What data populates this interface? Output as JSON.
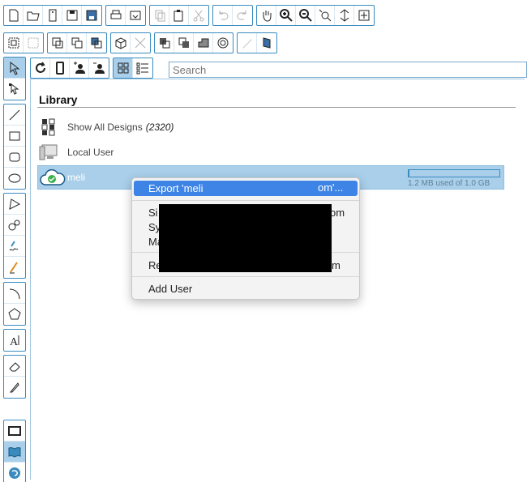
{
  "search": {
    "placeholder": "Search"
  },
  "library": {
    "title": "Library",
    "show_all_label": "Show All Designs",
    "show_all_count": "(2320)",
    "local_user_label": "Local User",
    "cloud_user_name": "meli",
    "storage_text": "1.2 MB used of 1.0 GB",
    "storage_fraction": 0.0012
  },
  "context_menu": {
    "export_label": "Export 'meli",
    "export_tail": "om'...",
    "item2_prefix": "Si",
    "item2_tail": "om",
    "item3_prefix": "Sy",
    "item4_prefix": "Ma",
    "item5_prefix": "Re",
    "item5_tail": "m",
    "add_user_label": "Add User"
  },
  "colors": {
    "accent": "#3a8bbf",
    "selection": "#a9cfea",
    "menu_highlight": "#3d84e6"
  }
}
